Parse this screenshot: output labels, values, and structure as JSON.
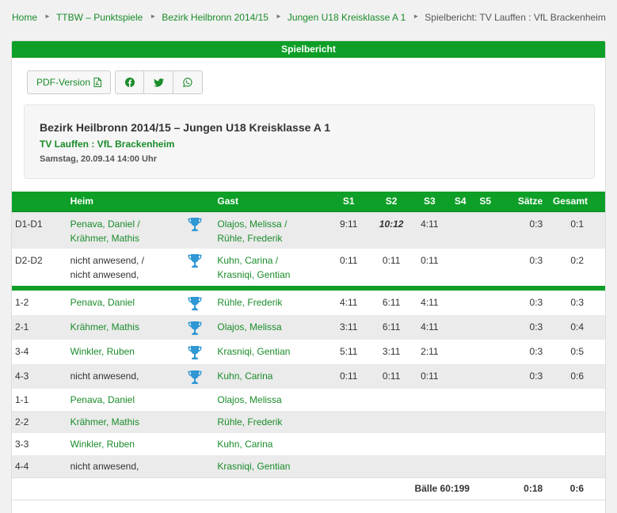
{
  "breadcrumb": {
    "items": [
      "Home",
      "TTBW – Punktspiele",
      "Bezirk Heilbronn 2014/15",
      "Jungen U18 Kreisklasse A 1"
    ],
    "current": "Spielbericht: TV Lauffen : VfL Brackenheim"
  },
  "panel": {
    "title": "Spielbericht"
  },
  "toolbar": {
    "pdf_label": "PDF-Version",
    "share_icons": [
      "facebook-icon",
      "twitter-icon",
      "whatsapp-icon"
    ]
  },
  "info": {
    "title": "Bezirk Heilbronn 2014/15 – Jungen U18 Kreisklasse A 1",
    "teams": "TV Lauffen : VfL Brackenheim",
    "date": "Samstag, 20.09.14 14:00 Uhr"
  },
  "table": {
    "headers": {
      "id": "",
      "heim": "Heim",
      "gast": "Gast",
      "s1": "S1",
      "s2": "S2",
      "s3": "S3",
      "s4": "S4",
      "s5": "S5",
      "saetze": "Sätze",
      "gesamt": "Gesamt"
    },
    "doubles": [
      {
        "id": "D1-D1",
        "heim1": "Penava, Daniel /",
        "heim2": "Krähmer, Mathis",
        "gast1": "Olajos, Melissa /",
        "gast2": "Rühle, Frederik",
        "s1": "9:11",
        "s2": "10:12",
        "s3": "4:11",
        "saetze": "0:3",
        "gesamt": "0:1"
      },
      {
        "id": "D2-D2",
        "heim1": "nicht anwesend, /",
        "heim2": "nicht anwesend,",
        "gast1": "Kuhn, Carina /",
        "gast2": "Krasniqi, Gentian",
        "s1": "0:11",
        "s2": "0:11",
        "s3": "0:11",
        "saetze": "0:3",
        "gesamt": "0:2"
      }
    ],
    "singles": [
      {
        "id": "1-2",
        "heim": "Penava, Daniel",
        "gast": "Rühle, Frederik",
        "s1": "4:11",
        "s2": "6:11",
        "s3": "4:11",
        "saetze": "0:3",
        "gesamt": "0:3"
      },
      {
        "id": "2-1",
        "heim": "Krähmer, Mathis",
        "gast": "Olajos, Melissa",
        "s1": "3:11",
        "s2": "6:11",
        "s3": "4:11",
        "saetze": "0:3",
        "gesamt": "0:4"
      },
      {
        "id": "3-4",
        "heim": "Winkler, Ruben",
        "gast": "Krasniqi, Gentian",
        "s1": "5:11",
        "s2": "3:11",
        "s3": "2:11",
        "saetze": "0:3",
        "gesamt": "0:5"
      },
      {
        "id": "4-3",
        "heim": "nicht anwesend,",
        "gast": "Kuhn, Carina",
        "s1": "0:11",
        "s2": "0:11",
        "s3": "0:11",
        "saetze": "0:3",
        "gesamt": "0:6"
      }
    ],
    "not_played": [
      {
        "id": "1-1",
        "heim": "Penava, Daniel",
        "gast": "Olajos, Melissa"
      },
      {
        "id": "2-2",
        "heim": "Krähmer, Mathis",
        "gast": "Rühle, Frederik"
      },
      {
        "id": "3-3",
        "heim": "Winkler, Ruben",
        "gast": "Kuhn, Carina"
      },
      {
        "id": "4-4",
        "heim": "nicht anwesend,",
        "gast": "Krasniqi, Gentian"
      }
    ],
    "totals": {
      "baelle": "Bälle 60:199",
      "saetze": "0:18",
      "gesamt": "0:6"
    }
  },
  "colors": {
    "accent": "#0d9f27",
    "link": "#1a8c2a",
    "cup": "#2e97d4",
    "row_alt": "#ebebeb"
  }
}
